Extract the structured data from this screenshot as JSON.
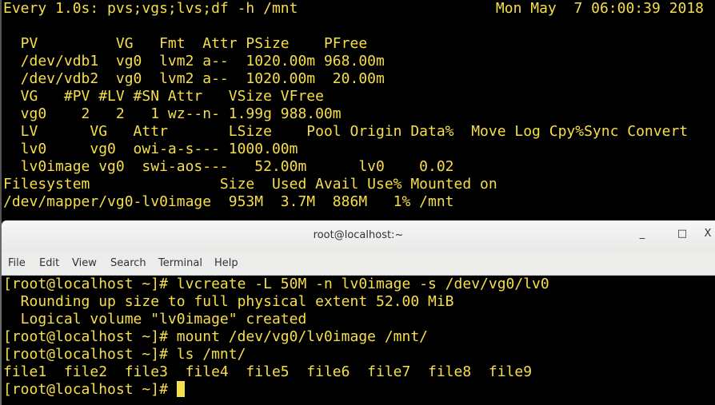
{
  "watch": {
    "header": "Every 1.0s: pvs;vgs;lvs;df -h /mnt",
    "date": "Mon May  7 06:00:39 2018",
    "lines": [
      "",
      "  PV         VG   Fmt  Attr PSize    PFree",
      "  /dev/vdb1  vg0  lvm2 a--  1020.00m 968.00m",
      "  /dev/vdb2  vg0  lvm2 a--  1020.00m  20.00m",
      "  VG   #PV #LV #SN Attr   VSize VFree",
      "  vg0    2   2   1 wz--n- 1.99g 988.00m",
      "  LV      VG   Attr       LSize    Pool Origin Data%  Move Log Cpy%Sync Convert",
      "  lv0     vg0  owi-a-s--- 1000.00m",
      "  lv0image vg0  swi-aos---   52.00m      lv0    0.02",
      "Filesystem               Size  Used Avail Use% Mounted on",
      "/dev/mapper/vg0-lv0image  953M  3.7M  886M   1% /mnt"
    ]
  },
  "window": {
    "title": "root@localhost:~",
    "minimize": "_",
    "maximize": "□",
    "close": "X",
    "menu": [
      "File",
      "Edit",
      "View",
      "Search",
      "Terminal",
      "Help"
    ]
  },
  "terminal": {
    "lines": [
      "[root@localhost ~]# lvcreate -L 50M -n lv0image -s /dev/vg0/lv0",
      "  Rounding up size to full physical extent 52.00 MiB",
      "  Logical volume \"lv0image\" created",
      "[root@localhost ~]# mount /dev/vg0/lv0image /mnt/",
      "[root@localhost ~]# ls /mnt/",
      "file1  file2  file3  file4  file5  file6  file7  file8  file9"
    ],
    "prompt": "[root@localhost ~]# "
  }
}
